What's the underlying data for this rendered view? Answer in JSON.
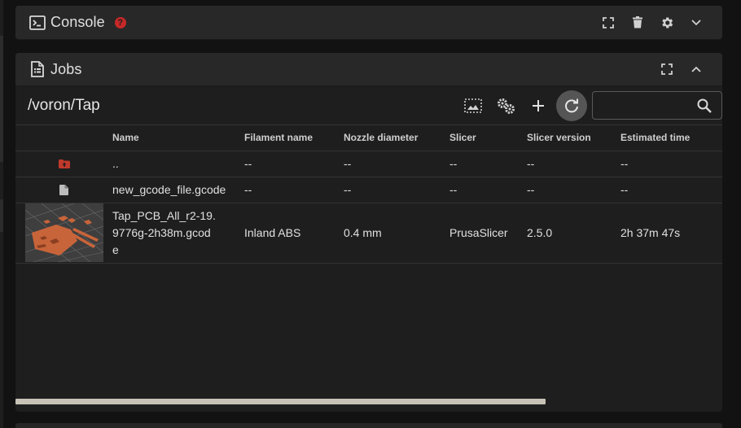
{
  "console": {
    "title": "Console",
    "help_badge": "?",
    "actions": [
      "fullscreen-icon",
      "delete-icon",
      "gear-icon",
      "chevron-down-icon"
    ]
  },
  "jobs": {
    "title": "Jobs",
    "actions": [
      "fullscreen-icon",
      "chevron-up-icon"
    ],
    "path": "/voron/Tap",
    "search": {
      "value": "",
      "placeholder": ""
    },
    "toolbar_icons": [
      "thumbnail-toggle-icon",
      "gears-icon",
      "plus-icon",
      "refresh-icon",
      "search-icon"
    ],
    "columns": [
      "Name",
      "Filament name",
      "Nozzle diameter",
      "Slicer",
      "Slicer version",
      "Estimated time"
    ],
    "rows": [
      {
        "type": "parent-folder",
        "icon": "folder-up-icon",
        "name": "..",
        "filament": "--",
        "nozzle": "--",
        "slicer": "--",
        "version": "--",
        "time": "--"
      },
      {
        "type": "file",
        "icon": "file-icon",
        "name": "new_gcode_file.gcode",
        "filament": "--",
        "nozzle": "--",
        "slicer": "--",
        "version": "--",
        "time": "--"
      },
      {
        "type": "gcode-thumb",
        "icon": "thumbnail",
        "name": "Tap_PCB_All_r2-19.9776g-2h38m.gcode",
        "filament": "Inland ABS",
        "nozzle": "0.4 mm",
        "slicer": "PrusaSlicer",
        "version": "2.5.0",
        "time": "2h 37m 47s"
      }
    ],
    "horizontal_scroll_fraction": 0.75
  },
  "colors": {
    "background": "#121212",
    "panel": "#1e1e1e",
    "panel_header": "#282828",
    "help_red": "#c62828",
    "thumbnail_orange": "#c8643a",
    "text": "#e6e6e6"
  }
}
